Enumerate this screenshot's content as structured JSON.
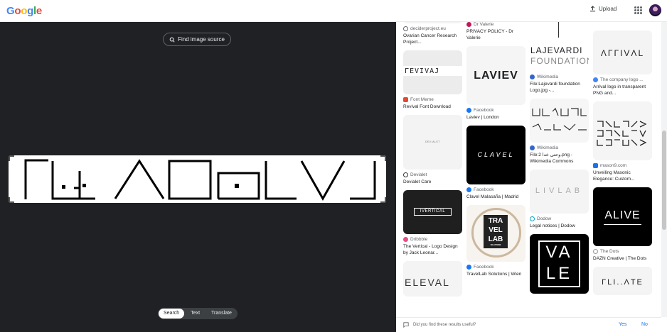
{
  "header": {
    "logo": "Google",
    "upload_label": "Upload",
    "icons": {
      "upload": "upload-icon",
      "apps": "apps-grid-icon",
      "avatar": "user-avatar"
    },
    "logo_colors": [
      "#4285F4",
      "#EA4335",
      "#FBBC05",
      "#4285F4",
      "#34A853",
      "#EA4335"
    ]
  },
  "viewer": {
    "find_source_label": "Find image source",
    "modes": [
      "Search",
      "Text",
      "Translate"
    ],
    "active_mode": "Search"
  },
  "results": {
    "col1": [
      {
        "source": "deciderproject.eu",
        "title": "Ovarian Cancer Research Project..."
      },
      {
        "image_text": "ΓEVIVAJ",
        "source": "Font Meme",
        "title": "Revival Font Download"
      },
      {
        "image_text": "DEVIALET",
        "source": "Devialet",
        "title": "Devialet Care"
      },
      {
        "image_text": "IVERTICAL",
        "source": "Dribbble",
        "title": "The Vertical - Logo Design by Jack Leonar..."
      },
      {
        "image_text": "ELEVAL"
      }
    ],
    "col2": [
      {
        "source": "Dr Valerie",
        "title": "PRIVACY POLICY - Dr Valerie"
      },
      {
        "image_text": "LAVIEV",
        "source": "Facebook",
        "title": "Laviev | London"
      },
      {
        "image_text": "CLAVEL",
        "source": "Facebook",
        "title": "Clavel Malasaña | Madrid"
      },
      {
        "image_lines": [
          "TRA",
          "VEL",
          "LAB"
        ],
        "image_sub": "SOLUTIONS",
        "source": "Facebook",
        "title": "TravelLab Solutions | Wien"
      }
    ],
    "col3": [
      {
        "image_text": "LAJEVARDI",
        "image_sub": "FOUNDATION",
        "source": "Wikimedia",
        "title": "File:Lajevardi foundation Logo.jpg -..."
      },
      {
        "source": "Wikimedia",
        "title": "File:2 وحتی خدا.png - Wikimedia Commons"
      },
      {
        "image_text": "LIVLAB",
        "source": "Dodow",
        "title": "Legal notices | Dodow"
      },
      {
        "image_lines": [
          "VA",
          "LE"
        ]
      }
    ],
    "col4": [
      {
        "image_text": "ΛΓΓIVΛL",
        "source": "The company logo ...",
        "title": "Arrival logo in transparent PNG and..."
      },
      {
        "source": "mason9.com",
        "title": "Unveiling Masonic Elegance: Custom..."
      },
      {
        "image_text": "ALIVE",
        "source": "The Dots",
        "title": "DAZN Creative | The Dots"
      },
      {
        "image_text": "ΓLI..ΛTE"
      }
    ]
  },
  "feedback": {
    "question": "Did you find these results useful?",
    "yes": "Yes",
    "no": "No"
  }
}
